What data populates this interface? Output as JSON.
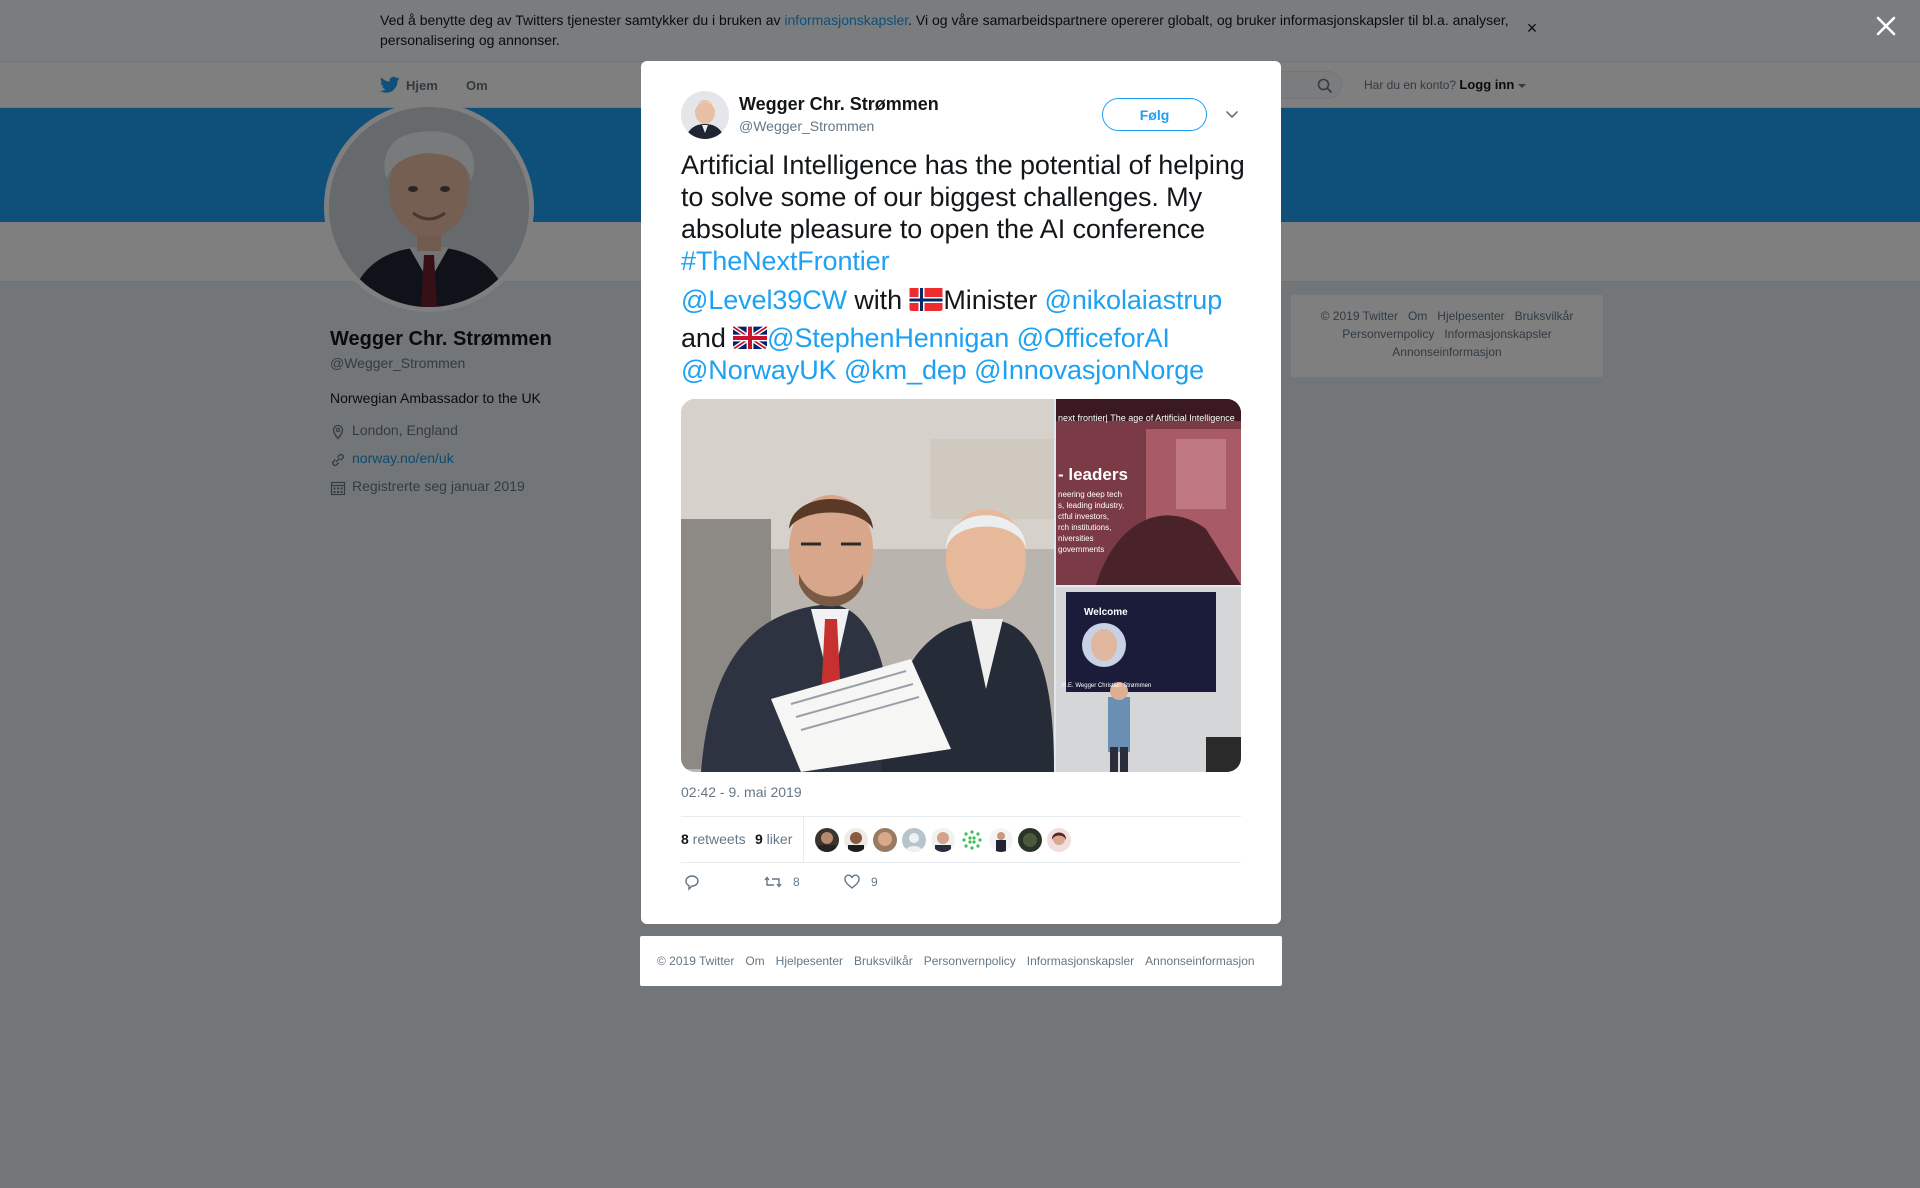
{
  "cookie": {
    "text_before": "Ved å benytte deg av Twitters tjenester samtykker du i bruken av ",
    "link": "informasjonskapsler",
    "text_after": ". Vi og våre samarbeidspartnere opererer globalt, og bruker informasjonskapsler til bl.a. analyser, personalisering og annonser.",
    "close": "×"
  },
  "nav": {
    "home": "Hjem",
    "about": "Om",
    "login_prompt": "Har du en konto?",
    "login": "Logg inn"
  },
  "profile": {
    "name": "Wegger Chr. Strømmen",
    "handle": "@Wegger_Strommen",
    "bio": "Norwegian Ambassador to the UK",
    "location": "London, England",
    "url": "norway.no/en/uk",
    "joined": "Registrerte seg januar 2019"
  },
  "side_footer": {
    "line1": [
      "© 2019 Twitter",
      "Om",
      "Hjelpesenter",
      "Bruksvilkår"
    ],
    "line2": [
      "Personvernpolicy",
      "Informasjonskapsler"
    ],
    "line3": [
      "Annonseinformasjon"
    ]
  },
  "tweet": {
    "name": "Wegger Chr. Strømmen",
    "handle": "@Wegger_Strommen",
    "follow": "Følg",
    "text_1": "Artificial Intelligence has the potential of helping to solve some of our biggest challenges. My absolute pleasure to open the AI conference ",
    "hashtag": "#TheNextFrontier",
    "mention_1": "@Level39CW",
    "with": " with ",
    "minister": "Minister ",
    "mention_2": "@nikolaiastrup",
    "and": "and ",
    "mention_3": "@StephenHennigan",
    "mention_4": "@OfficeforAI",
    "mention_5": "@NorwayUK",
    "mention_6": "@km_dep",
    "mention_7": "@InnovasjonNorge",
    "media_tr_title": "next frontier| The age of Artificial Intelligence",
    "media_tr_heading": "- leaders",
    "media_tr_lines": [
      "neering deep tech",
      "s, leading industry,",
      "ctful investors,",
      "rch institutions,",
      "niversities",
      "governments"
    ],
    "media_br_welcome": "Welcome",
    "media_br_caption": "H.E. Wegger Christian Strømmen",
    "time": "02:42 - 9. mai 2019",
    "retweets_count": "8",
    "retweets_label": " retweets",
    "likes_count": "9",
    "likes_label": " liker",
    "action_retweets": "8",
    "action_likes": "9"
  },
  "modal_footer": [
    "© 2019 Twitter",
    "Om",
    "Hjelpesenter",
    "Bruksvilkår",
    "Personvernpolicy",
    "Informasjonskapsler",
    "Annonseinformasjon"
  ],
  "colors": {
    "twitter_blue": "#1da1f2",
    "link_blue": "#1b95e0",
    "text": "#14171a",
    "muted": "#657786",
    "background": "#e6ecf0"
  }
}
